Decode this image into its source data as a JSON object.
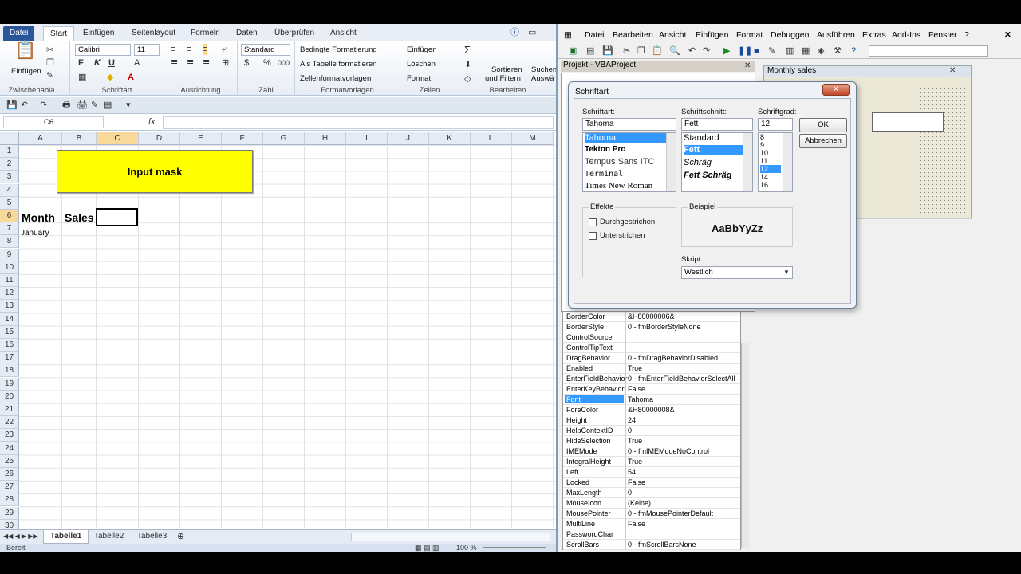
{
  "excel": {
    "tabs": [
      "Datei",
      "Start",
      "Einfügen",
      "Seitenlayout",
      "Formeln",
      "Daten",
      "Überprüfen",
      "Ansicht"
    ],
    "ribbon": {
      "clipboard_label": "Zwischenabla...",
      "paste_label": "Einfügen",
      "font_name": "Calibri",
      "font_size": "11",
      "font_group": "Schriftart",
      "align_group": "Ausrichtung",
      "number_format": "Standard",
      "number_group": "Zahl",
      "cond_format": "Bedingte Formatierung",
      "as_table": "Als Tabelle formatieren",
      "cell_styles": "Zellenformatvorlagen",
      "styles_group": "Formatvorlagen",
      "insert": "Einfügen",
      "delete": "Löschen",
      "format": "Format",
      "cells_group": "Zellen",
      "sort": "Sortieren",
      "filter": "und Filtern",
      "search": "Suchen",
      "search2": "Auswä",
      "edit_group": "Bearbeiten"
    },
    "name_box": "C6",
    "fx": "fx",
    "columns": [
      "A",
      "B",
      "C",
      "D",
      "E",
      "F",
      "G",
      "H",
      "I",
      "J",
      "K",
      "L",
      "M"
    ],
    "rows": [
      "1",
      "2",
      "3",
      "4",
      "5",
      "6",
      "7",
      "8",
      "9",
      "10",
      "11",
      "12",
      "13",
      "14",
      "15",
      "16",
      "17",
      "18",
      "19",
      "20",
      "21",
      "22",
      "23",
      "24",
      "25",
      "26",
      "27",
      "28",
      "29",
      "30"
    ],
    "button_text": "Input mask",
    "cell_a6": "Month",
    "cell_b6": "Sales",
    "cell_a7": "January",
    "sheets": [
      "Tabelle1",
      "Tabelle2",
      "Tabelle3"
    ],
    "status": "Bereit",
    "zoom": "100 %"
  },
  "vba": {
    "menu": [
      "Datei",
      "Bearbeiten",
      "Ansicht",
      "Einfügen",
      "Format",
      "Debuggen",
      "Ausführen",
      "Extras",
      "Add-Ins",
      "Fenster",
      "?"
    ],
    "project_title": "Projekt - VBAProject",
    "userform_title": "Monthly sales",
    "properties": [
      {
        "k": "BorderColor",
        "v": "&H80000006&"
      },
      {
        "k": "BorderStyle",
        "v": "0 - fmBorderStyleNone"
      },
      {
        "k": "ControlSource",
        "v": ""
      },
      {
        "k": "ControlTipText",
        "v": ""
      },
      {
        "k": "DragBehavior",
        "v": "0 - fmDragBehaviorDisabled"
      },
      {
        "k": "Enabled",
        "v": "True"
      },
      {
        "k": "EnterFieldBehavior",
        "v": "0 - fmEnterFieldBehaviorSelectAll"
      },
      {
        "k": "EnterKeyBehavior",
        "v": "False"
      },
      {
        "k": "Font",
        "v": "Tahoma"
      },
      {
        "k": "ForeColor",
        "v": "&H80000008&"
      },
      {
        "k": "Height",
        "v": "24"
      },
      {
        "k": "HelpContextID",
        "v": "0"
      },
      {
        "k": "HideSelection",
        "v": "True"
      },
      {
        "k": "IMEMode",
        "v": "0 - fmIMEModeNoControl"
      },
      {
        "k": "IntegralHeight",
        "v": "True"
      },
      {
        "k": "Left",
        "v": "54"
      },
      {
        "k": "Locked",
        "v": "False"
      },
      {
        "k": "MaxLength",
        "v": "0"
      },
      {
        "k": "MouseIcon",
        "v": "(Keine)"
      },
      {
        "k": "MousePointer",
        "v": "0 - fmMousePointerDefault"
      },
      {
        "k": "MultiLine",
        "v": "False"
      },
      {
        "k": "PasswordChar",
        "v": ""
      },
      {
        "k": "ScrollBars",
        "v": "0 - fmScrollBarsNone"
      }
    ]
  },
  "dialog": {
    "title": "Schriftart",
    "font_label": "Schriftart:",
    "font_value": "Tahoma",
    "fonts": [
      "Tahoma",
      "Tekton Pro",
      "Tempus Sans ITC",
      "Terminal",
      "Times New Roman"
    ],
    "style_label": "Schriftschnitt:",
    "style_value": "Fett",
    "styles": [
      "Standard",
      "Fett",
      "Schräg",
      "Fett Schräg"
    ],
    "size_label": "Schriftgrad:",
    "size_value": "12",
    "sizes": [
      "8",
      "9",
      "10",
      "11",
      "12",
      "14",
      "16"
    ],
    "ok": "OK",
    "cancel": "Abbrechen",
    "effects_label": "Effekte",
    "strike": "Durchgestrichen",
    "underline": "Unterstrichen",
    "sample_label": "Beispiel",
    "sample_text": "AaBbYyZz",
    "script_label": "Skript:",
    "script_value": "Westlich"
  }
}
